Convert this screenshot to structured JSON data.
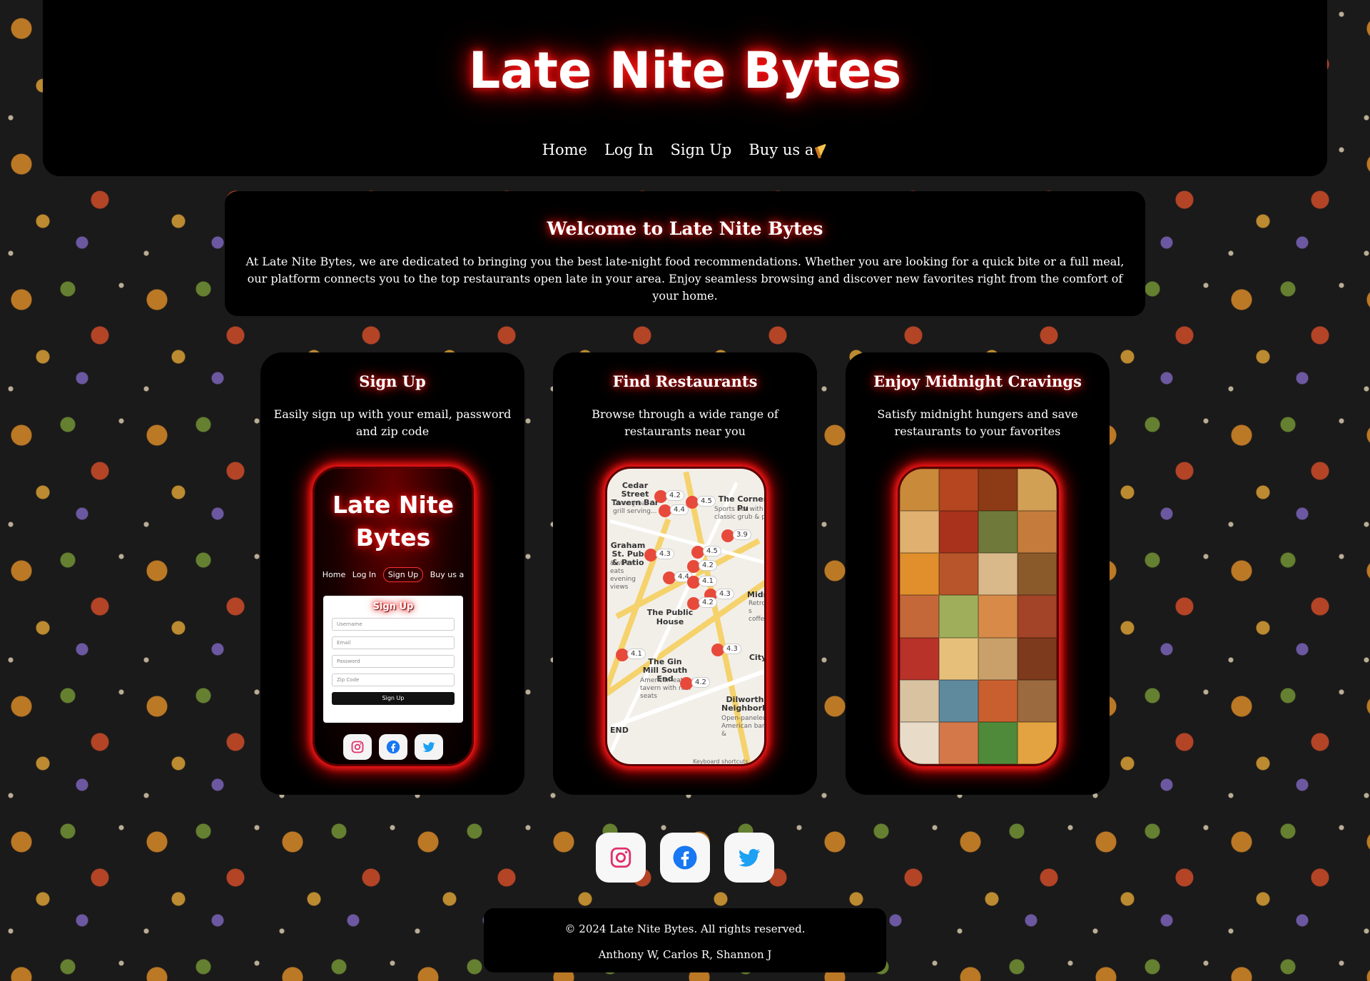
{
  "site": {
    "title": "Late Nite Bytes"
  },
  "nav": {
    "items": [
      "Home",
      "Log In",
      "Sign Up",
      "Buy us a"
    ]
  },
  "welcome": {
    "title": "Welcome to Late Nite Bytes",
    "body": "At Late Nite Bytes, we are dedicated to bringing you the best late-night food recommendations. Whether you are looking for a quick bite or a full meal, our platform connects you to the top restaurants open late in your area. Enjoy seamless browsing and discover new favorites right from the comfort of your home."
  },
  "cards": [
    {
      "title": "Sign Up",
      "text": "Easily sign up with your email, password and zip code"
    },
    {
      "title": "Find Restaurants",
      "text": "Browse through a wide range of restaurants near you"
    },
    {
      "title": "Enjoy Midnight Cravings",
      "text": "Satisfy midnight hungers and save restaurants to your favorites"
    }
  ],
  "mock_signup": {
    "title": "Late Nite Bytes",
    "nav": [
      "Home",
      "Log In",
      "Sign Up",
      "Buy us a"
    ],
    "form_title": "Sign Up",
    "fields": [
      "Username",
      "Email",
      "Password",
      "Zip Code"
    ],
    "button": "Sign Up"
  },
  "mock_map": {
    "labels": {
      "cedar": "Cedar Street Tavern Bar",
      "cedar_sub": "Cheery bar & grill serving...",
      "corner": "The Corner Pu",
      "corner_sub": "Sports bar with classic grub & p",
      "graham": "Graham St. Pub & Patio",
      "graham_sub": "& street eats evening views",
      "public": "The Public House",
      "gin": "The Gin Mill South End",
      "gin_sub": "American eatery & tavern with roof seats",
      "city": "City",
      "dilworth": "Dilworth Neighborhood",
      "dilworth_sub": "Open-paneled American bar &",
      "midni": "Midni",
      "midni_sub": "Retro-s coffee",
      "end": "END",
      "keyboard": "Keyboard shortcuts"
    },
    "ratings": [
      "4.2",
      "4.4",
      "4.5",
      "3.9",
      "4.3",
      "4.5",
      "4.2",
      "4.4",
      "4.1",
      "4.3",
      "4.2",
      "4.1",
      "4.3",
      "4.2"
    ]
  },
  "footer": {
    "copyright": "© 2024 Late Nite Bytes. All rights reserved.",
    "authors": "Anthony W, Carlos R, Shannon J"
  },
  "colors": {
    "glow": "#ff1a1a",
    "panel": "#000000",
    "instagram": "#e1306c",
    "facebook": "#1877f2",
    "twitter": "#1da1f2"
  },
  "icons": [
    "instagram-icon",
    "facebook-icon",
    "twitter-icon",
    "pizza-icon"
  ]
}
